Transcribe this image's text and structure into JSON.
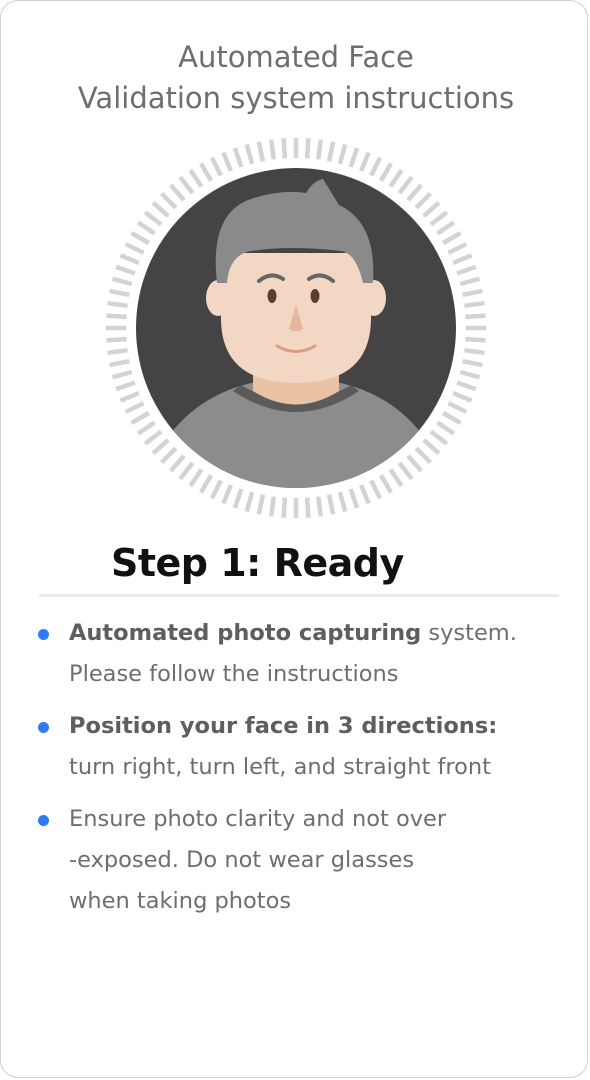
{
  "header": {
    "title_line1": "Automated Face",
    "title_line2": "Validation system instructions"
  },
  "illustration": {
    "icon": "face-avatar-icon",
    "ring_color": "#d3d3d3",
    "background_color": "#444444",
    "hair_color": "#8a8a8a",
    "skin_color": "#f2d7c4",
    "shirt_color": "#8c8c8c"
  },
  "step": {
    "title": "Step 1: Ready"
  },
  "instructions": [
    {
      "bold": "Automated photo capturing",
      "text": " system.",
      "line2": "Please follow the instructions"
    },
    {
      "bold": "Position your face in 3 directions:",
      "text": "",
      "line2": "turn right, turn left, and straight front"
    },
    {
      "bold": "",
      "text": "Ensure photo clarity and not over",
      "line2": "-exposed. Do not wear glasses",
      "line3": "when taking photos"
    }
  ],
  "colors": {
    "bullet": "#2f7bf5",
    "text": "#6e6e6e",
    "heading": "#111111"
  }
}
